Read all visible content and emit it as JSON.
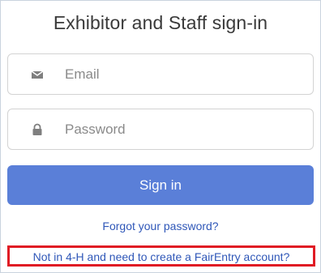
{
  "title": "Exhibitor and Staff sign-in",
  "email": {
    "placeholder": "Email",
    "icon": "envelope-icon"
  },
  "password": {
    "placeholder": "Password",
    "icon": "lock-icon"
  },
  "signin_button": {
    "label": "Sign in",
    "color": "#5a7fd8"
  },
  "forgot_link": "Forgot your password?",
  "create_account_link": "Not in 4-H and need to create a FairEntry account?",
  "highlight_color": "#e01b24",
  "link_color": "#2f57b8"
}
